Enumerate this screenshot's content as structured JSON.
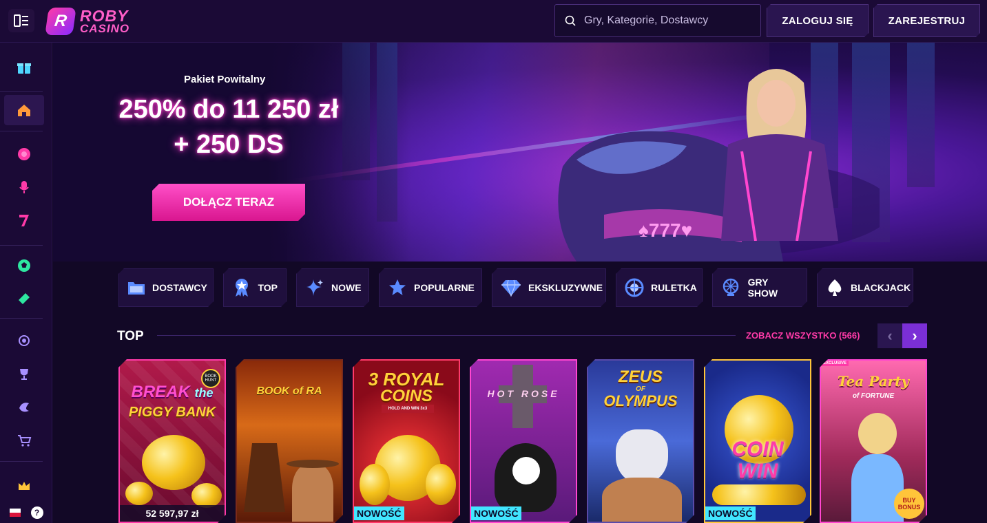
{
  "header": {
    "logo_line1": "ROBY",
    "logo_line2": "CASINO",
    "logo_mark": "R",
    "search_placeholder": "Gry, Kategorie, Dostawcy",
    "login_label": "ZALOGUJ SIĘ",
    "register_label": "ZAREJESTRUJ"
  },
  "sidebar": {
    "items": [
      {
        "icon": "gift-icon"
      },
      {
        "icon": "home-icon",
        "active": true
      },
      {
        "icon": "roulette-chip-icon"
      },
      {
        "icon": "microphone-icon"
      },
      {
        "icon": "seven-icon"
      },
      {
        "icon": "soccer-ball-icon"
      },
      {
        "icon": "ticket-icon"
      },
      {
        "icon": "badge-icon"
      },
      {
        "icon": "trophy-icon"
      },
      {
        "icon": "tournament-icon"
      },
      {
        "icon": "cart-icon"
      },
      {
        "icon": "crown-icon"
      }
    ],
    "help_label": "?"
  },
  "hero": {
    "pre_title": "Pakiet Powitalny",
    "title_line1": "250% do 11 250 zł",
    "title_line2": "+ 250 DS",
    "cta_label": "DOŁĄCZ TERAZ",
    "bike_plate": "♠777♥"
  },
  "categories": [
    {
      "label": "DOSTAWCY",
      "icon": "folder-icon"
    },
    {
      "label": "TOP",
      "icon": "award-icon"
    },
    {
      "label": "NOWE",
      "icon": "sparkle-icon"
    },
    {
      "label": "POPULARNE",
      "icon": "star-icon"
    },
    {
      "label": "EKSKLUZYWNE",
      "icon": "diamond-icon"
    },
    {
      "label": "RULETKA",
      "icon": "roulette-icon"
    },
    {
      "label": "GRY SHOW",
      "icon": "wheel-icon"
    },
    {
      "label": "BLACKJACK",
      "icon": "spade-icon"
    }
  ],
  "top_section": {
    "title": "TOP",
    "see_all_label": "ZOBACZ WSZYSTKO (566)",
    "prev": "‹",
    "next": "›"
  },
  "games": [
    {
      "title_a": "BREAK",
      "title_b": "the",
      "title_c": "PIGGY BANK",
      "corner": "BOOK HUNT",
      "jackpot": "52 597,97 zł"
    },
    {
      "title": "BOOK of RA",
      "badge": ""
    },
    {
      "title_a": "3 ROYAL",
      "title_b": "COINS",
      "subtitle": "HOLD AND WIN 3x3",
      "badge": "NOWOŚĆ"
    },
    {
      "title": "HOT ROSE",
      "badge": "NOWOŚĆ"
    },
    {
      "title_a": "ZEUS",
      "title_b": "OF",
      "title_c": "OLYMPUS",
      "badge": ""
    },
    {
      "title_a": "COIN",
      "title_b": "WIN",
      "badge": "NOWOŚĆ"
    },
    {
      "title_a": "Tea Party",
      "title_b": "of FORTUNE",
      "corner": "EXCLUSIVE",
      "bonus": "BUY BONUS",
      "badge": ""
    }
  ]
}
